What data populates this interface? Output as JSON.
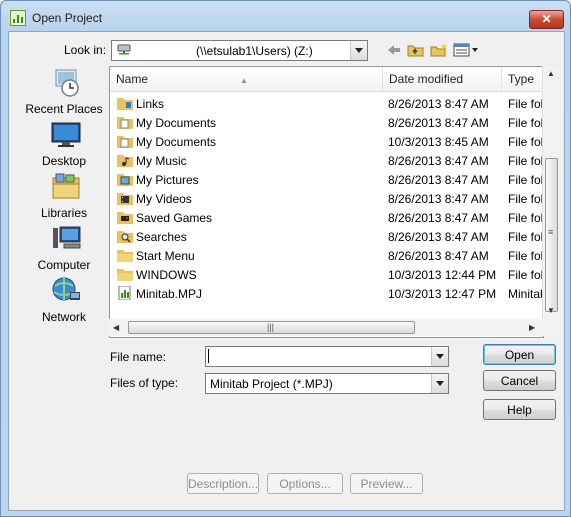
{
  "window": {
    "title": "Open Project",
    "close_label": "✕"
  },
  "lookin": {
    "label": "Look in:",
    "value": "(\\\\etsulab1\\Users) (Z:)"
  },
  "places": [
    {
      "label": "Recent Places",
      "icon": "recent-places-icon"
    },
    {
      "label": "Desktop",
      "icon": "desktop-icon"
    },
    {
      "label": "Libraries",
      "icon": "libraries-icon"
    },
    {
      "label": "Computer",
      "icon": "computer-icon"
    },
    {
      "label": "Network",
      "icon": "network-icon"
    }
  ],
  "columns": {
    "name": "Name",
    "date": "Date modified",
    "type": "Type"
  },
  "files": [
    {
      "name": "Links",
      "date": "8/26/2013 8:47 AM",
      "type": "File folder",
      "icon": "links-folder-icon"
    },
    {
      "name": "My Documents",
      "date": "8/26/2013 8:47 AM",
      "type": "File folder",
      "icon": "documents-folder-icon"
    },
    {
      "name": "My Documents",
      "date": "10/3/2013 8:45 AM",
      "type": "File folder",
      "icon": "documents-folder-icon"
    },
    {
      "name": "My Music",
      "date": "8/26/2013 8:47 AM",
      "type": "File folder",
      "icon": "music-folder-icon"
    },
    {
      "name": "My Pictures",
      "date": "8/26/2013 8:47 AM",
      "type": "File folder",
      "icon": "pictures-folder-icon"
    },
    {
      "name": "My Videos",
      "date": "8/26/2013 8:47 AM",
      "type": "File folder",
      "icon": "videos-folder-icon"
    },
    {
      "name": "Saved Games",
      "date": "8/26/2013 8:47 AM",
      "type": "File folder",
      "icon": "saved-games-folder-icon"
    },
    {
      "name": "Searches",
      "date": "8/26/2013 8:47 AM",
      "type": "File folder",
      "icon": "searches-folder-icon"
    },
    {
      "name": "Start Menu",
      "date": "8/26/2013 8:47 AM",
      "type": "File folder",
      "icon": "folder-icon"
    },
    {
      "name": "WINDOWS",
      "date": "10/3/2013 12:44 PM",
      "type": "File folder",
      "icon": "folder-icon"
    },
    {
      "name": "Minitab.MPJ",
      "date": "10/3/2013 12:47 PM",
      "type": "Minitab Project",
      "icon": "minitab-file-icon"
    }
  ],
  "filename": {
    "label": "File name:",
    "value": ""
  },
  "filetype": {
    "label": "Files of type:",
    "value": "Minitab Project (*.MPJ)"
  },
  "buttons": {
    "open": "Open",
    "cancel": "Cancel",
    "help": "Help",
    "description": "Description...",
    "options": "Options...",
    "preview": "Preview..."
  },
  "colors": {
    "title_bg": "#c4daf0",
    "close_red": "#cb4b33",
    "folder": "#e8c25a",
    "accent": "#3c7fb1"
  }
}
